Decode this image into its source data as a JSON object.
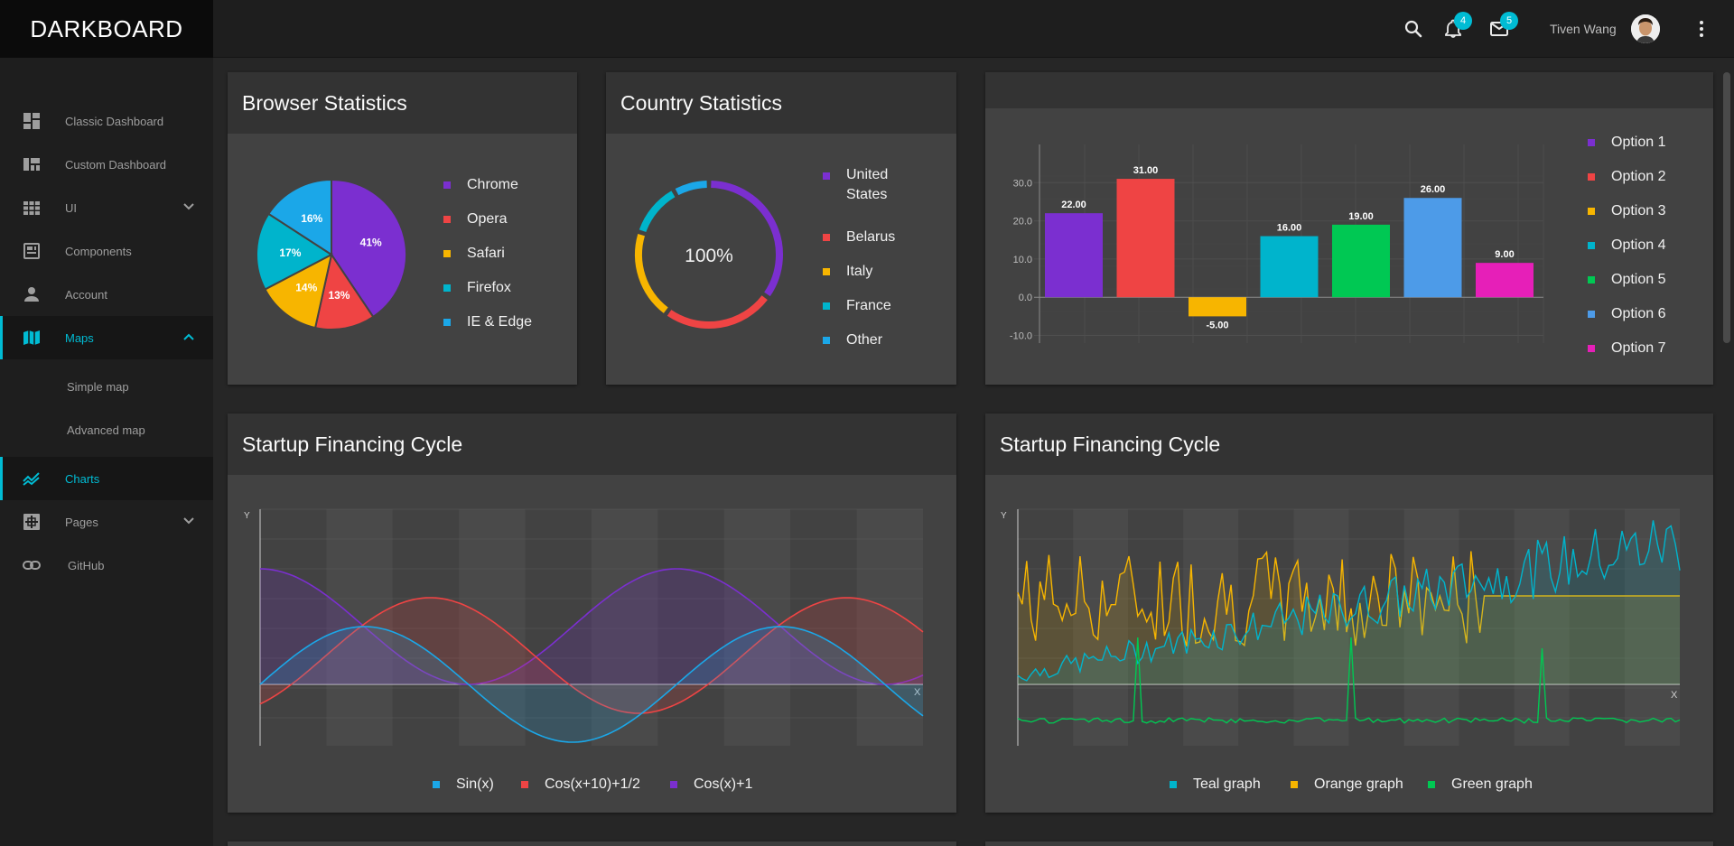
{
  "app": {
    "brand": "DARKBOARD"
  },
  "header": {
    "user_name": "Tiven Wang",
    "notifications_count": "4",
    "messages_count": "5",
    "icons": [
      "search-icon",
      "bell-icon",
      "mail-icon",
      "more-vert-icon"
    ]
  },
  "sidebar": {
    "items": [
      {
        "label": "Classic Dashboard",
        "icon": "dashboard-icon"
      },
      {
        "label": "Custom Dashboard",
        "icon": "view-quilt-icon"
      },
      {
        "label": "UI",
        "icon": "grid-icon"
      },
      {
        "label": "Components",
        "icon": "components-icon"
      },
      {
        "label": "Account",
        "icon": "person-icon"
      },
      {
        "label": "Maps",
        "icon": "map-icon"
      },
      {
        "label": "Simple map",
        "icon": ""
      },
      {
        "label": "Advanced map",
        "icon": ""
      },
      {
        "label": "Charts",
        "icon": "chart-line-icon"
      },
      {
        "label": "Pages",
        "icon": "pages-icon"
      },
      {
        "label": "GitHub",
        "icon": "link-icon"
      }
    ]
  },
  "colors": {
    "accent": "#00bcd4",
    "purple": "#7b2fd0",
    "red": "#ef4444",
    "yellow": "#f7b500",
    "teal": "#00b4cc",
    "blue": "#1ba7e8",
    "green": "#00c853",
    "lightblue": "#4d9be8",
    "pink": "#e61fb8"
  },
  "browser_stats": {
    "title": "Browser Statistics",
    "legend": [
      "Chrome",
      "Opera",
      "Safari",
      "Firefox",
      "IE & Edge"
    ]
  },
  "country_stats": {
    "title": "Country Statistics",
    "center_label": "100%",
    "legend": [
      "United States",
      "Belarus",
      "Italy",
      "France",
      "Other"
    ]
  },
  "bar_card": {
    "title": "",
    "legend": [
      "Option 1",
      "Option 2",
      "Option 3",
      "Option 4",
      "Option 5",
      "Option 6",
      "Option 7"
    ]
  },
  "financing_left": {
    "title": "Startup Financing Cycle",
    "legend": [
      "Sin(x)",
      "Cos(x+10)+1/2",
      "Cos(x)+1"
    ],
    "x_axis_label": "X",
    "y_axis_label": "Y"
  },
  "financing_right": {
    "title": "Startup Financing Cycle",
    "legend": [
      "Teal graph",
      "Orange graph",
      "Green graph"
    ],
    "x_axis_label": "X",
    "y_axis_label": "Y"
  },
  "chart_data": [
    {
      "type": "pie",
      "categories": [
        "Chrome",
        "Opera",
        "Safari",
        "Firefox",
        "IE & Edge"
      ],
      "values": [
        41,
        13,
        14,
        17,
        16
      ],
      "labels": [
        "41%",
        "13%",
        "14%",
        "17%",
        "16%"
      ],
      "colors": [
        "#7b2fd0",
        "#ef4444",
        "#f7b500",
        "#00b4cc",
        "#1ba7e8"
      ]
    },
    {
      "type": "pie",
      "variant": "donut",
      "categories": [
        "United States",
        "Belarus",
        "Italy",
        "France",
        "Other"
      ],
      "values": [
        35,
        25,
        20,
        12,
        8
      ],
      "center_label": "100%",
      "colors": [
        "#7b2fd0",
        "#ef4444",
        "#f7b500",
        "#00b4cc",
        "#1ba7e8"
      ]
    },
    {
      "type": "bar",
      "categories": [
        "Option 1",
        "Option 2",
        "Option 3",
        "Option 4",
        "Option 5",
        "Option 6",
        "Option 7"
      ],
      "values": [
        22.0,
        31.0,
        -5.0,
        16.0,
        19.0,
        26.0,
        9.0
      ],
      "value_labels": [
        "22.00",
        "31.00",
        "-5.00",
        "16.00",
        "19.00",
        "26.00",
        "9.00"
      ],
      "yticks": [
        "30.0",
        "20.0",
        "10.0",
        "0.0",
        "-10.0"
      ],
      "ylim": [
        -12,
        40
      ],
      "colors": [
        "#7b2fd0",
        "#ef4444",
        "#f7b500",
        "#00b4cc",
        "#00c853",
        "#4d9be8",
        "#e61fb8"
      ]
    },
    {
      "type": "area",
      "series": [
        {
          "name": "Sin(x)",
          "formula": "sin(x)"
        },
        {
          "name": "Cos(x+10)+1/2",
          "formula": "cos(x+10)+0.5"
        },
        {
          "name": "Cos(x)+1",
          "formula": "cos(x)+1"
        }
      ],
      "xlim": [
        0,
        10
      ],
      "ylim": [
        -2,
        3
      ],
      "xlabel": "X",
      "ylabel": "Y",
      "colors": [
        "#1ba7e8",
        "#ef4444",
        "#7b2fd0"
      ]
    },
    {
      "type": "area",
      "series": [
        {
          "name": "Teal graph",
          "trend": "rising noisy, 0.3 to 5.8"
        },
        {
          "name": "Orange graph",
          "trend": "oscillating 1.5 to 5, flattening at 3 after x≈0.7"
        },
        {
          "name": "Green graph",
          "trend": "flat near -1.3 with three spikes to ~1.5"
        }
      ],
      "xlabel": "X",
      "ylabel": "Y",
      "ylim": [
        -2,
        6
      ],
      "colors": [
        "#00b4cc",
        "#f7b500",
        "#00c853"
      ]
    }
  ]
}
